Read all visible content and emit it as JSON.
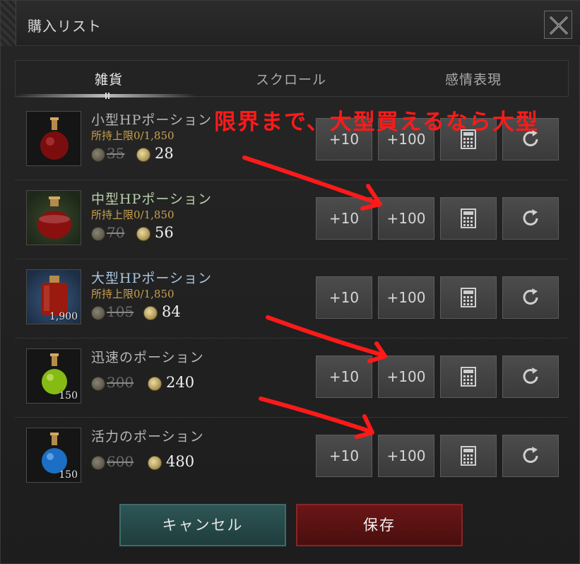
{
  "window": {
    "title": "購入リスト"
  },
  "tabs": [
    {
      "label": "雑貨",
      "active": true
    },
    {
      "label": "スクロール",
      "active": false
    },
    {
      "label": "感情表現",
      "active": false
    }
  ],
  "items": [
    {
      "name": "小型HPポーション",
      "limit": "所持上限0/1,850",
      "old_price": "35",
      "price": "28",
      "qty": "",
      "color": "#8a1010"
    },
    {
      "name": "中型HPポーション",
      "limit": "所持上限0/1,850",
      "old_price": "70",
      "price": "56",
      "qty": "",
      "color": "#9a1212"
    },
    {
      "name": "大型HPポーション",
      "limit": "所持上限0/1,850",
      "old_price": "105",
      "price": "84",
      "qty": "1,900",
      "color": "#a01a10"
    },
    {
      "name": "迅速のポーション",
      "limit": "",
      "old_price": "300",
      "price": "240",
      "qty": "150",
      "color": "#8fc21a"
    },
    {
      "name": "活力のポーション",
      "limit": "",
      "old_price": "600",
      "price": "480",
      "qty": "150",
      "color": "#1f7fd0"
    }
  ],
  "buttons": {
    "plus10": "+10",
    "plus100": "+100",
    "calculator_icon": "calculator-icon",
    "reset_icon": "refresh-icon"
  },
  "annotation": "限界まで、大型買えるなら大型",
  "footer": {
    "cancel": "キャンセル",
    "save": "保存"
  }
}
